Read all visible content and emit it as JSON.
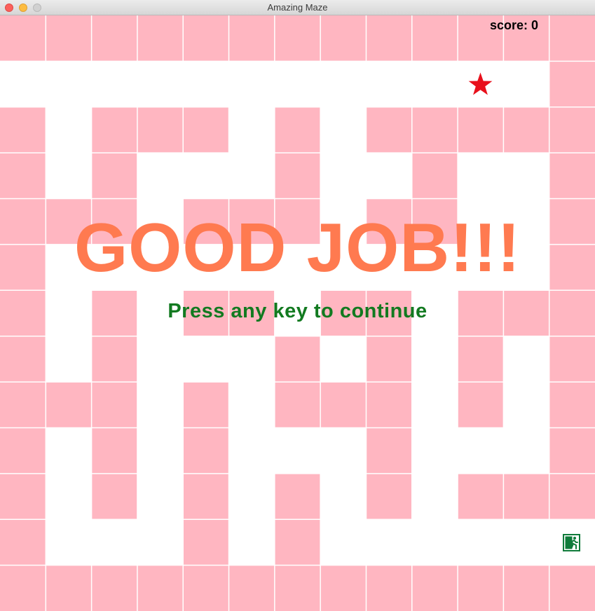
{
  "window": {
    "title": "Amazing Maze"
  },
  "hud": {
    "score_text": "score: 0"
  },
  "overlay": {
    "headline": "GOOD JOB!!!",
    "prompt": "Press any key to continue"
  },
  "maze": {
    "rows": 13,
    "cols": 13,
    "wall_color": "#ffb6c1",
    "grid": [
      "#############",
      "............#",
      "#.###.#.#####",
      "#.#...#..#..#",
      "###.###.##..#",
      "#...........#",
      "#.#.##.##.###",
      "#.#...#.#.#.#",
      "###.#.###.#.#",
      "#.#.#...#...#",
      "#.#.#.#.#.###",
      "#...#.#.....E",
      "#############"
    ],
    "player_cell": [
      1,
      10
    ],
    "exit_cell": [
      11,
      12
    ]
  },
  "icons": {
    "player": "star-icon",
    "exit": "emergency-exit-icon",
    "player_color": "#e8101c",
    "exit_color": "#0f7b3a"
  }
}
